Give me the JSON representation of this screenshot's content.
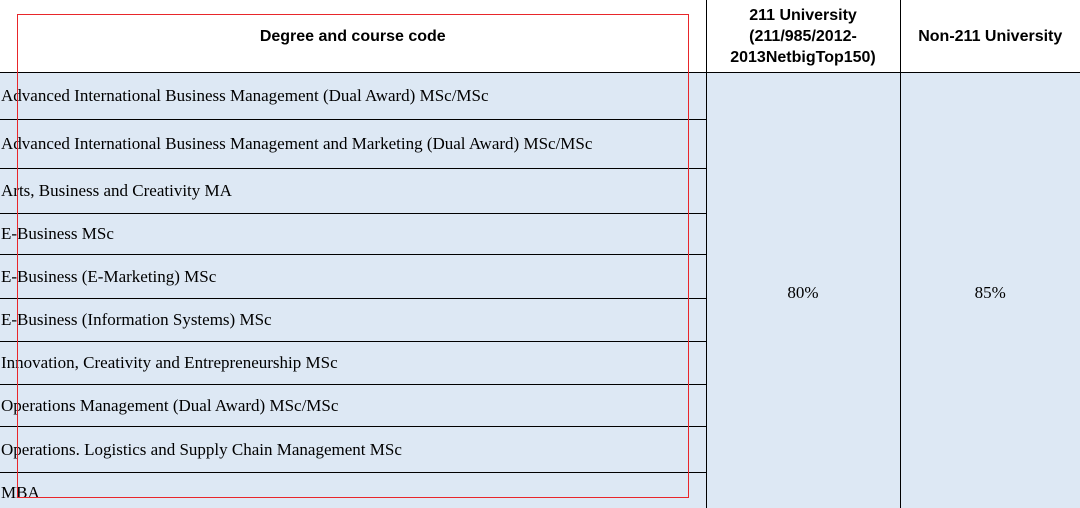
{
  "table": {
    "headers": {
      "degree": "Degree and course code",
      "uni211_lines": [
        "211 University",
        "(211/985/2012-",
        "2013NetbigTop150)"
      ],
      "non211": "Non-211 University"
    },
    "rows": [
      "Advanced International Business Management (Dual Award) MSc/MSc",
      "Advanced International Business Management and Marketing (Dual Award) MSc/MSc",
      "Arts, Business and Creativity MA",
      "E-Business MSc",
      "E-Business (E-Marketing) MSc",
      "E-Business (Information Systems) MSc",
      "Innovation, Creativity and Entrepreneurship MSc",
      "Operations Management (Dual Award) MSc/MSc",
      "Operations. Logistics and Supply Chain Management MSc",
      "MBA"
    ],
    "rate_211": "80%",
    "rate_non211": "85%"
  },
  "colors": {
    "cell_fill": "#dde8f4",
    "highlight_border": "#e8262a"
  }
}
